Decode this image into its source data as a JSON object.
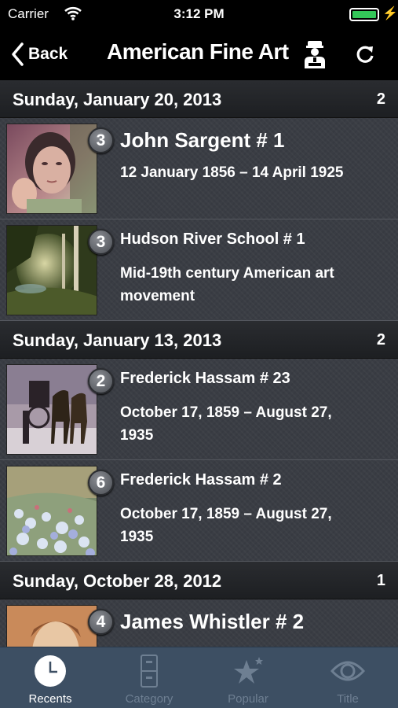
{
  "status": {
    "carrier": "Carrier",
    "time": "3:12 PM"
  },
  "nav": {
    "back_label": "Back",
    "title": "American Fine Art"
  },
  "sections": [
    {
      "date": "Sunday, January 20, 2013",
      "count": "2"
    },
    {
      "date": "Sunday, January 13, 2013",
      "count": "2"
    },
    {
      "date": "Sunday, October 28, 2012",
      "count": "1"
    }
  ],
  "items": [
    {
      "badge": "3",
      "name": "John Sargent # 1",
      "desc": "12 January 1856 – 14 April 1925"
    },
    {
      "badge": "3",
      "name": "Hudson River School # 1",
      "desc": "Mid-19th century American art movement"
    },
    {
      "badge": "2",
      "name": "Frederick Hassam # 23",
      "desc": "October 17, 1859 – August 27, 1935"
    },
    {
      "badge": "6",
      "name": "Frederick Hassam # 2",
      "desc": "October 17, 1859 – August 27, 1935"
    },
    {
      "badge": "4",
      "name": "James Whistler # 2",
      "desc": ""
    }
  ],
  "tabs": [
    {
      "label": "Recents",
      "icon": "clock-icon",
      "active": true
    },
    {
      "label": "Category",
      "icon": "cabinet-icon",
      "active": false
    },
    {
      "label": "Popular",
      "icon": "stars-icon",
      "active": false
    },
    {
      "label": "Title",
      "icon": "eye-icon",
      "active": false
    }
  ],
  "colors": {
    "tabbar": "#3d4f63",
    "battery": "#34c759",
    "background": "#3a3d44"
  }
}
